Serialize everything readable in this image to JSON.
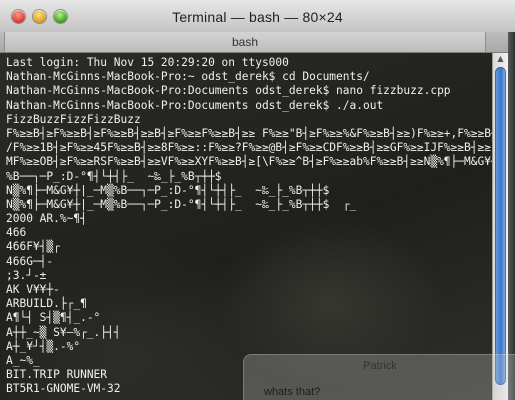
{
  "window": {
    "title": "Terminal — bash — 80×24"
  },
  "tabs": [
    {
      "label": "bash"
    }
  ],
  "terminal": {
    "lines": [
      "Last login: Thu Nov 15 20:29:20 on ttys000",
      "Nathan-McGinns-MacBook-Pro:~ odst_derek$ cd Documents/",
      "Nathan-McGinns-MacBook-Pro:Documents odst_derek$ nano fizzbuzz.cpp",
      "Nathan-McGinns-MacBook-Pro:Documents odst_derek$ ./a.out",
      "FizzBuzzFizzFizzBuzz",
      "F%≥≥B┤≥F%≥≥B┤≥F%≥≥B┤≥≥B┤≥F%≥≥F%≥≥B┤≥≥ F%≥≥\"B┤≥F%≥≥%&F%≥≥B┤≥≥)F%≥≥+,F%≥≥B┤≥≥.",
      "/F%≥≥1B┤≥F%≥≥45F%≥≥B┤≥≥8F%≥≥::F%≥≥?F%≥≥@B┤≥F%≥≥CDF%≥≥B┤≥≥GF%≥≥IJF%≥≥B┤≥≥L",
      "MF%≥≥OB┤≥F%≥≥RSF%≥≥B┤≥≥VF%≥≥XYF%≥≥B┤≥[\\F%≥≥^B┤≥F%≥≥ab%F%≥≥B┤≥≥N▒%¶├─M&G¥┼|_▒",
      "%B──┐─P_:D-°¶┤└┼┤├_  ~‰_├_%B┬┼┼$",
      "N▒%¶├─M&G¥┼|_─M▒%B──┐─P_:D-°¶┤└┼┤├_  ~‰_├_%B┬┼┼$",
      "N▒%¶├─M&G¥┼|_─M▒%B──┐─P_:D-°¶┤└┼┤├_  ~‰_├_%B┬┼┼$  ┌_",
      "2000 AR.%~¶┤",
      "466",
      "466F¥┤▒┌",
      "466G─┤-",
      ";3.┘-±",
      "AK V¥¥┼-",
      "ARBUILD.├┌_¶",
      "A¶└┤ S┤▒¶┤_.-°",
      "A┼┼_~▒ S¥—%┌_.├┤┤",
      "A┼_¥┘┤▒.-%°",
      "A_~%_",
      "BIT.TRIP RUNNER",
      "BT5R1-GNOME-VM-32"
    ]
  },
  "notification": {
    "title": "Patrick",
    "message": "whats that?"
  },
  "icons": {
    "close": "close-icon",
    "minimize": "minimize-icon",
    "zoom": "zoom-icon"
  },
  "colors": {
    "terminal_text": "#f0f0f0",
    "scroll_thumb": "#3b74c9",
    "close": "#d6382c",
    "minimize": "#d99a15",
    "zoom": "#3a9b1c"
  }
}
